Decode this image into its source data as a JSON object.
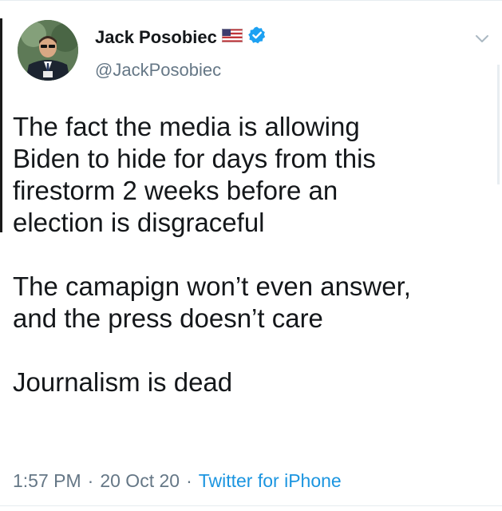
{
  "author": {
    "name": "Jack Posobiec",
    "handle": "@JackPosobiec",
    "flag_icon": "us-flag-icon",
    "verified_icon": "verified-badge-icon",
    "verified_color": "#1da1f2"
  },
  "tweet": {
    "paragraphs": [
      "The fact the media is allowing\nBiden to hide for days from this\nfirestorm 2 weeks before an\nelection is disgraceful",
      "The camapign won’t even answer,\nand the press doesn’t care",
      "Journalism is dead"
    ]
  },
  "meta": {
    "time": "1:57 PM",
    "sep1": "·",
    "date": "20 Oct 20",
    "sep2": "·",
    "source": "Twitter for iPhone",
    "source_color": "#1b95e0"
  },
  "menu": {
    "icon": "chevron-down-icon"
  }
}
